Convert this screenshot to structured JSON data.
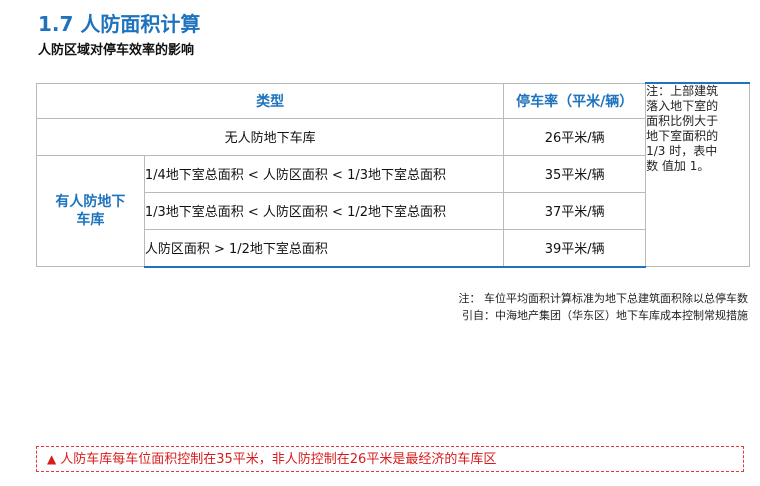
{
  "title": "1.7 人防面积计算",
  "subtitle": "人防区域对停车效率的影响",
  "table": {
    "header_type": "类型",
    "header_rate": "停车率（平米/辆）",
    "rows": [
      {
        "category": "无人防地下车库",
        "rate": "26平米/辆"
      },
      {
        "condition": "1/4地下室总面积 < 人防区面积 < 1/3地下室总面积",
        "rate": "35平米/辆"
      },
      {
        "condition": "1/3地下室总面积 < 人防区面积 < 1/2地下室总面积",
        "rate": "37平米/辆"
      },
      {
        "condition": "人防区面积 > 1/2地下室总面积",
        "rate": "39平米/辆"
      }
    ],
    "group_label_line1": "有人防地下",
    "group_label_line2": "车库",
    "note_lines": [
      "注：上部建筑",
      "落入地下室的",
      "面积比例大于",
      "地下室面积的",
      "1/3 时，表中",
      "数 值加 1。"
    ]
  },
  "footnote": {
    "line1": "注： 车位平均面积计算标准为地下总建筑面积除以总停车数",
    "line2": "引自：中海地产集团（华东区）地下车库成本控制常规措施"
  },
  "alert": {
    "icon": "warning-triangle-icon",
    "text": "人防车库每车位面积控制在35平米，非人防控制在26平米是最经济的车库区"
  },
  "colors": {
    "accent": "#1e73be",
    "alert": "#d71c1c"
  }
}
